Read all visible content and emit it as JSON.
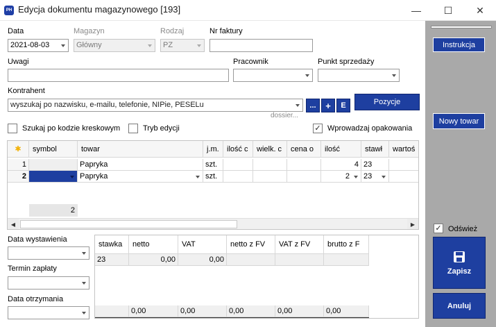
{
  "window": {
    "title": "Edycja dokumentu magazynowego [193]",
    "icon_text": "PH",
    "minimize_glyph": "—",
    "maximize_glyph": "☐",
    "close_glyph": "✕"
  },
  "form": {
    "data_label": "Data",
    "data_value": "2021-08-03",
    "magazyn_label": "Magazyn",
    "magazyn_value": "Główny",
    "rodzaj_label": "Rodzaj",
    "rodzaj_value": "PZ",
    "nr_faktury_label": "Nr faktury",
    "nr_faktury_value": "",
    "uwagi_label": "Uwagi",
    "uwagi_value": "",
    "pracownik_label": "Pracownik",
    "pracownik_value": "",
    "punkt_label": "Punkt sprzedaży",
    "punkt_value": "",
    "kontrahent_label": "Kontrahent",
    "kontrahent_placeholder": "wyszukaj po nazwisku, e-mailu, telefonie, NIPie, PESELu",
    "dossier_link": "dossier...",
    "btn_dots": "...",
    "btn_plus": "+",
    "btn_e": "E",
    "pozycje_button": "Pozycje"
  },
  "options": {
    "szukaj_kod": {
      "label": "Szukaj po kodzie kreskowym",
      "checked": false
    },
    "tryb_edycji": {
      "label": "Tryb edycji",
      "checked": false
    },
    "opakowania": {
      "label": "Wprowadzaj opakowania",
      "checked": true
    },
    "check_glyph": "✓"
  },
  "grid": {
    "star_icon": "✱",
    "columns": [
      "symbol",
      "towar",
      "j.m.",
      "ilość c",
      "wielk. c",
      "cena o",
      "ilość",
      "stawł",
      "wartoś"
    ],
    "rows": [
      {
        "lp": "1",
        "symbol": "",
        "towar": "Papryka",
        "jm": "szt.",
        "ilosc_c": "",
        "wielk": "",
        "cena": "",
        "ilosc": "4",
        "stawka": "23"
      },
      {
        "lp": "2",
        "symbol": "",
        "towar": "Papryka",
        "jm": "szt.",
        "ilosc_c": "",
        "wielk": "",
        "cena": "",
        "ilosc": "2",
        "stawka": "23"
      }
    ],
    "footer_count": "2"
  },
  "dates": {
    "wystawienia_label": "Data wystawienia",
    "wystawienia_value": "",
    "termin_label": "Termin zapłaty",
    "termin_value": "",
    "otrzymania_label": "Data otrzymania",
    "otrzymania_value": ""
  },
  "vat_table": {
    "columns": [
      "stawka",
      "netto",
      "VAT",
      "netto z FV",
      "VAT z FV",
      "brutto z F"
    ],
    "row": [
      "23",
      "0,00",
      "0,00",
      "",
      "",
      ""
    ],
    "totals": [
      "",
      "0,00",
      "0,00",
      "0,00",
      "0,00",
      "0,00"
    ]
  },
  "sidebar": {
    "instrukcja": "Instrukcja",
    "nowy_towar": "Nowy towar",
    "odswiez": {
      "label": "Odśwież",
      "checked": true
    },
    "zapisz": "Zapisz",
    "anuluj": "Anuluj"
  },
  "colors": {
    "accent": "#1e3fa0",
    "sidebar_bg": "#a9a9a9",
    "selected_cell": "#1e3fa0"
  }
}
